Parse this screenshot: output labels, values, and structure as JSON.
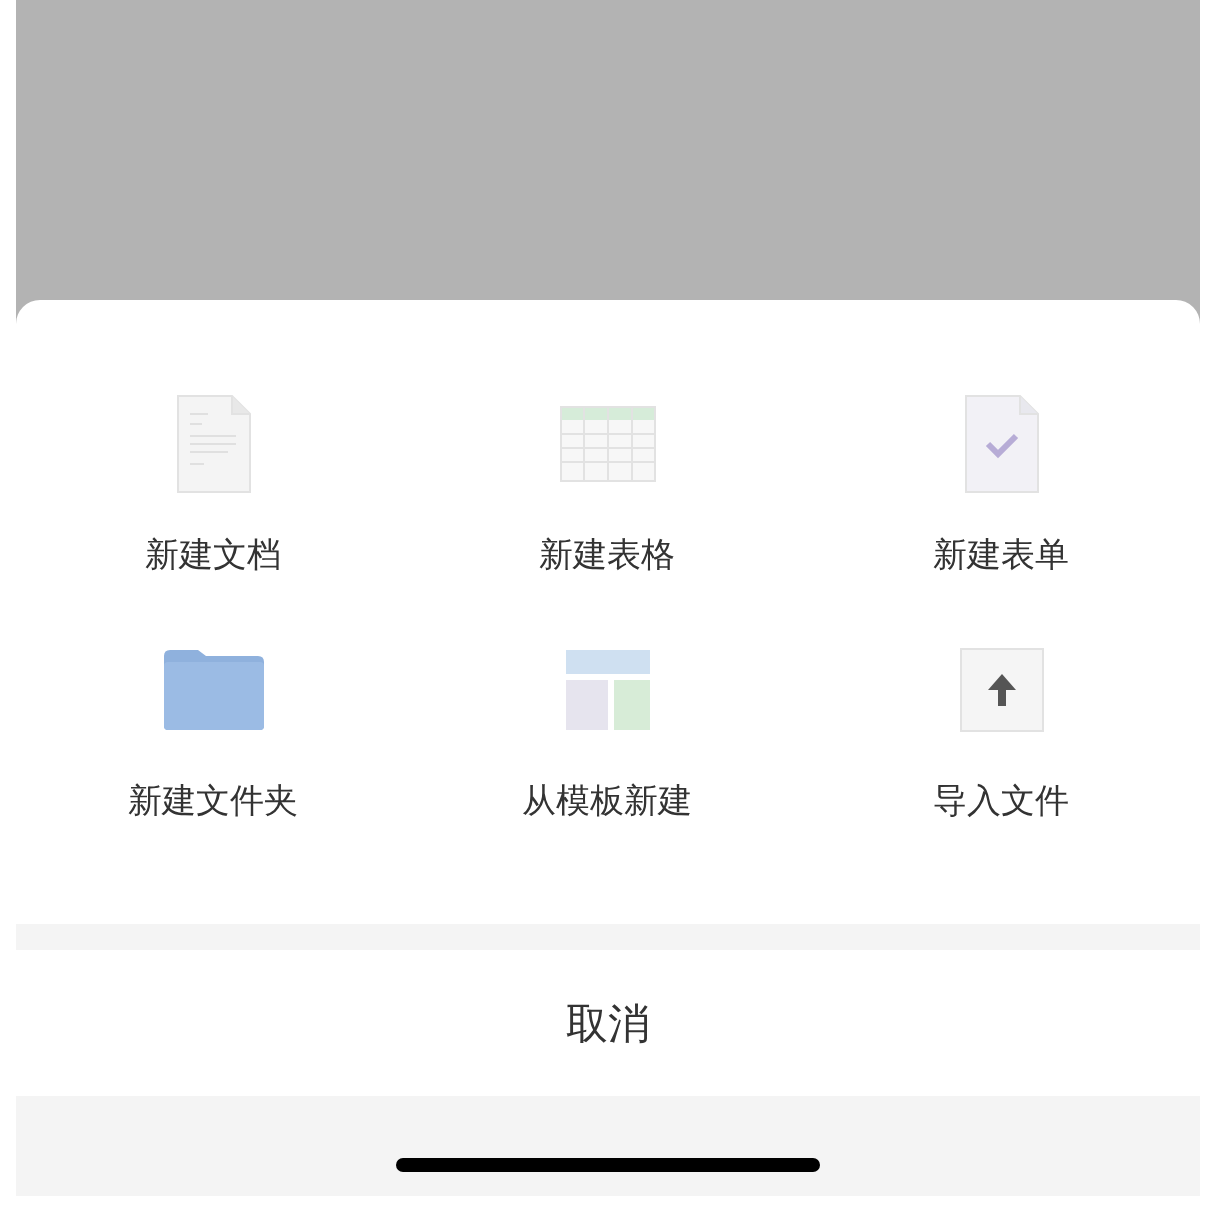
{
  "actions": [
    {
      "kind": "doc",
      "label": "新建文档"
    },
    {
      "kind": "sheet",
      "label": "新建表格"
    },
    {
      "kind": "form",
      "label": "新建表单"
    },
    {
      "kind": "folder",
      "label": "新建文件夹"
    },
    {
      "kind": "template",
      "label": "从模板新建"
    },
    {
      "kind": "import",
      "label": "导入文件"
    }
  ],
  "cancel": "取消"
}
